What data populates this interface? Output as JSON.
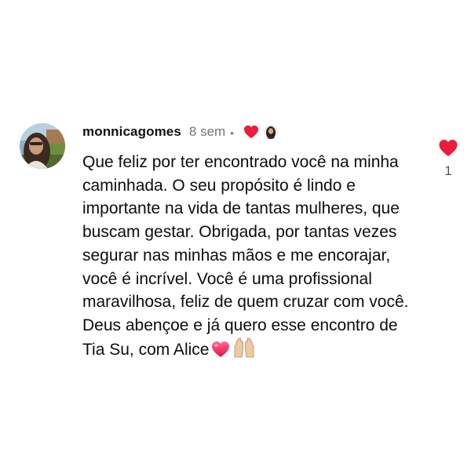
{
  "comment": {
    "username": "monnicagomes",
    "time": "8 sem",
    "separator": "•",
    "text": "Que feliz por ter encontrado você na minha caminhada. O seu propósito é lindo e importante na vida de tantas mulheres, que buscam gestar. Obrigada, por tantas vezes segurar nas minhas mãos e me encorajar, você é incrível. Você é uma profissional maravilhosa, feliz de quem cruzar com você. Deus abençoe e já quero esse encontro de Tia Su, com Alice",
    "emojis": [
      "heart-emoji",
      "raising-hands-emoji"
    ],
    "liked_by_author": true,
    "like_count": "1"
  },
  "icons": {
    "like": "heart-icon",
    "author_heart": "heart-icon"
  },
  "colors": {
    "heart": "#ed1c3b",
    "username": "#111111",
    "meta": "#737373",
    "text": "#0d0d0d"
  }
}
